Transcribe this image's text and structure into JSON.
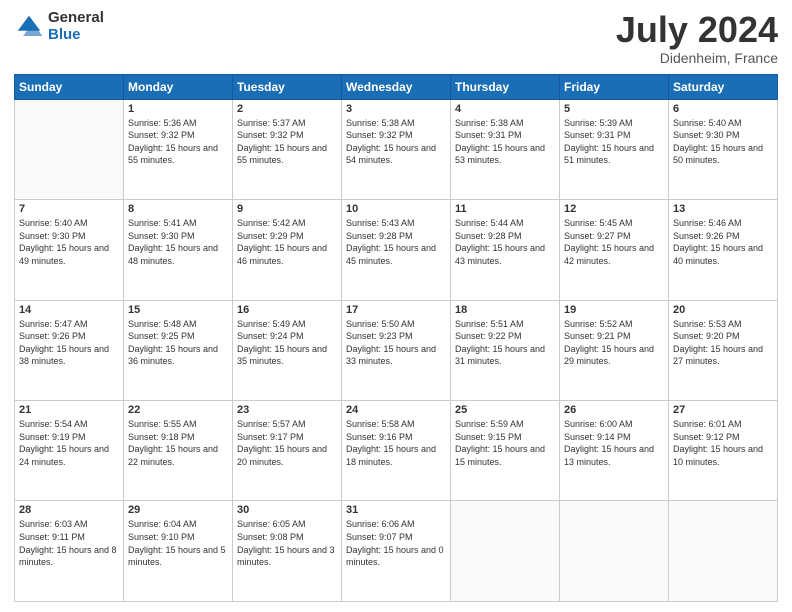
{
  "header": {
    "logo_general": "General",
    "logo_blue": "Blue",
    "title": "July 2024",
    "subtitle": "Didenheim, France"
  },
  "days": [
    "Sunday",
    "Monday",
    "Tuesday",
    "Wednesday",
    "Thursday",
    "Friday",
    "Saturday"
  ],
  "weeks": [
    {
      "cells": [
        {
          "date": "",
          "empty": true
        },
        {
          "date": "1",
          "sunrise": "Sunrise: 5:36 AM",
          "sunset": "Sunset: 9:32 PM",
          "daylight": "Daylight: 15 hours and 55 minutes."
        },
        {
          "date": "2",
          "sunrise": "Sunrise: 5:37 AM",
          "sunset": "Sunset: 9:32 PM",
          "daylight": "Daylight: 15 hours and 55 minutes."
        },
        {
          "date": "3",
          "sunrise": "Sunrise: 5:38 AM",
          "sunset": "Sunset: 9:32 PM",
          "daylight": "Daylight: 15 hours and 54 minutes."
        },
        {
          "date": "4",
          "sunrise": "Sunrise: 5:38 AM",
          "sunset": "Sunset: 9:31 PM",
          "daylight": "Daylight: 15 hours and 53 minutes."
        },
        {
          "date": "5",
          "sunrise": "Sunrise: 5:39 AM",
          "sunset": "Sunset: 9:31 PM",
          "daylight": "Daylight: 15 hours and 51 minutes."
        },
        {
          "date": "6",
          "sunrise": "Sunrise: 5:40 AM",
          "sunset": "Sunset: 9:30 PM",
          "daylight": "Daylight: 15 hours and 50 minutes."
        }
      ]
    },
    {
      "cells": [
        {
          "date": "7",
          "sunrise": "Sunrise: 5:40 AM",
          "sunset": "Sunset: 9:30 PM",
          "daylight": "Daylight: 15 hours and 49 minutes."
        },
        {
          "date": "8",
          "sunrise": "Sunrise: 5:41 AM",
          "sunset": "Sunset: 9:30 PM",
          "daylight": "Daylight: 15 hours and 48 minutes."
        },
        {
          "date": "9",
          "sunrise": "Sunrise: 5:42 AM",
          "sunset": "Sunset: 9:29 PM",
          "daylight": "Daylight: 15 hours and 46 minutes."
        },
        {
          "date": "10",
          "sunrise": "Sunrise: 5:43 AM",
          "sunset": "Sunset: 9:28 PM",
          "daylight": "Daylight: 15 hours and 45 minutes."
        },
        {
          "date": "11",
          "sunrise": "Sunrise: 5:44 AM",
          "sunset": "Sunset: 9:28 PM",
          "daylight": "Daylight: 15 hours and 43 minutes."
        },
        {
          "date": "12",
          "sunrise": "Sunrise: 5:45 AM",
          "sunset": "Sunset: 9:27 PM",
          "daylight": "Daylight: 15 hours and 42 minutes."
        },
        {
          "date": "13",
          "sunrise": "Sunrise: 5:46 AM",
          "sunset": "Sunset: 9:26 PM",
          "daylight": "Daylight: 15 hours and 40 minutes."
        }
      ]
    },
    {
      "cells": [
        {
          "date": "14",
          "sunrise": "Sunrise: 5:47 AM",
          "sunset": "Sunset: 9:26 PM",
          "daylight": "Daylight: 15 hours and 38 minutes."
        },
        {
          "date": "15",
          "sunrise": "Sunrise: 5:48 AM",
          "sunset": "Sunset: 9:25 PM",
          "daylight": "Daylight: 15 hours and 36 minutes."
        },
        {
          "date": "16",
          "sunrise": "Sunrise: 5:49 AM",
          "sunset": "Sunset: 9:24 PM",
          "daylight": "Daylight: 15 hours and 35 minutes."
        },
        {
          "date": "17",
          "sunrise": "Sunrise: 5:50 AM",
          "sunset": "Sunset: 9:23 PM",
          "daylight": "Daylight: 15 hours and 33 minutes."
        },
        {
          "date": "18",
          "sunrise": "Sunrise: 5:51 AM",
          "sunset": "Sunset: 9:22 PM",
          "daylight": "Daylight: 15 hours and 31 minutes."
        },
        {
          "date": "19",
          "sunrise": "Sunrise: 5:52 AM",
          "sunset": "Sunset: 9:21 PM",
          "daylight": "Daylight: 15 hours and 29 minutes."
        },
        {
          "date": "20",
          "sunrise": "Sunrise: 5:53 AM",
          "sunset": "Sunset: 9:20 PM",
          "daylight": "Daylight: 15 hours and 27 minutes."
        }
      ]
    },
    {
      "cells": [
        {
          "date": "21",
          "sunrise": "Sunrise: 5:54 AM",
          "sunset": "Sunset: 9:19 PM",
          "daylight": "Daylight: 15 hours and 24 minutes."
        },
        {
          "date": "22",
          "sunrise": "Sunrise: 5:55 AM",
          "sunset": "Sunset: 9:18 PM",
          "daylight": "Daylight: 15 hours and 22 minutes."
        },
        {
          "date": "23",
          "sunrise": "Sunrise: 5:57 AM",
          "sunset": "Sunset: 9:17 PM",
          "daylight": "Daylight: 15 hours and 20 minutes."
        },
        {
          "date": "24",
          "sunrise": "Sunrise: 5:58 AM",
          "sunset": "Sunset: 9:16 PM",
          "daylight": "Daylight: 15 hours and 18 minutes."
        },
        {
          "date": "25",
          "sunrise": "Sunrise: 5:59 AM",
          "sunset": "Sunset: 9:15 PM",
          "daylight": "Daylight: 15 hours and 15 minutes."
        },
        {
          "date": "26",
          "sunrise": "Sunrise: 6:00 AM",
          "sunset": "Sunset: 9:14 PM",
          "daylight": "Daylight: 15 hours and 13 minutes."
        },
        {
          "date": "27",
          "sunrise": "Sunrise: 6:01 AM",
          "sunset": "Sunset: 9:12 PM",
          "daylight": "Daylight: 15 hours and 10 minutes."
        }
      ]
    },
    {
      "cells": [
        {
          "date": "28",
          "sunrise": "Sunrise: 6:03 AM",
          "sunset": "Sunset: 9:11 PM",
          "daylight": "Daylight: 15 hours and 8 minutes."
        },
        {
          "date": "29",
          "sunrise": "Sunrise: 6:04 AM",
          "sunset": "Sunset: 9:10 PM",
          "daylight": "Daylight: 15 hours and 5 minutes."
        },
        {
          "date": "30",
          "sunrise": "Sunrise: 6:05 AM",
          "sunset": "Sunset: 9:08 PM",
          "daylight": "Daylight: 15 hours and 3 minutes."
        },
        {
          "date": "31",
          "sunrise": "Sunrise: 6:06 AM",
          "sunset": "Sunset: 9:07 PM",
          "daylight": "Daylight: 15 hours and 0 minutes."
        },
        {
          "date": "",
          "empty": true
        },
        {
          "date": "",
          "empty": true
        },
        {
          "date": "",
          "empty": true
        }
      ]
    }
  ]
}
